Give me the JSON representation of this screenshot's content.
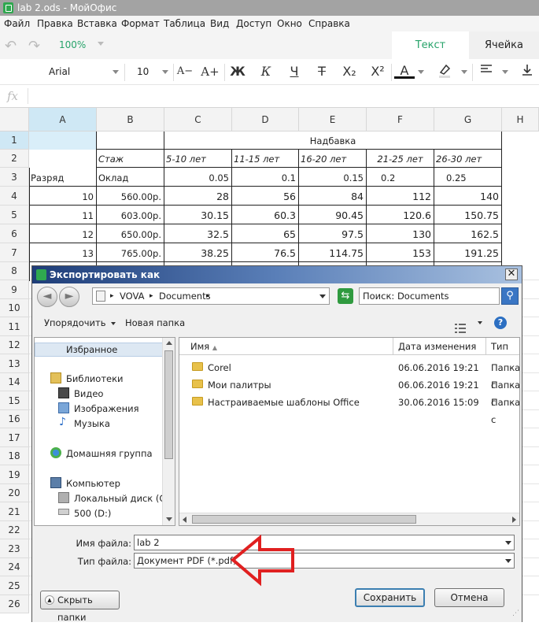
{
  "app": {
    "title": "lab 2.ods - МойОфис"
  },
  "menu": [
    "Файл",
    "Правка",
    "Вставка",
    "Формат",
    "Таблица",
    "Вид",
    "Доступ",
    "Окно",
    "Справка"
  ],
  "toolbar": {
    "zoom": "100%",
    "tab_text": "Текст",
    "tab_cell": "Ячейка",
    "font_name": "Arial",
    "font_size": "10",
    "format_buttons": [
      "A−",
      "A+",
      "Ж",
      "К",
      "Ч",
      "Т",
      "X₂",
      "X²",
      "A",
      "",
      "",
      ""
    ]
  },
  "formula_bar": {
    "fx_label": "fx"
  },
  "sheet": {
    "columns": [
      "A",
      "B",
      "C",
      "D",
      "E",
      "F",
      "G",
      "H"
    ],
    "rows": [
      "1",
      "2",
      "3",
      "4",
      "5",
      "6",
      "7",
      "8",
      "9",
      "10",
      "11",
      "12",
      "13",
      "14",
      "15",
      "16",
      "17",
      "18",
      "19",
      "20",
      "21",
      "22",
      "23",
      "24",
      "25",
      "26"
    ],
    "header_nadbavka": "Надбавка",
    "row2": {
      "b": "Стаж",
      "c": "5-10 лет",
      "d": "11-15 лет",
      "e": "16-20 лет",
      "f": "21-25 лет",
      "g": "26-30 лет"
    },
    "row3": {
      "a": "Разряд",
      "b": "Оклад",
      "c": "0.05",
      "d": "0.1",
      "e": "0.15",
      "f": "0.2",
      "g": "0.25"
    },
    "data_rows": [
      {
        "a": "10",
        "b": "560.00р.",
        "c": "28",
        "d": "56",
        "e": "84",
        "f": "112",
        "g": "140"
      },
      {
        "a": "11",
        "b": "603.00р.",
        "c": "30.15",
        "d": "60.3",
        "e": "90.45",
        "f": "120.6",
        "g": "150.75"
      },
      {
        "a": "12",
        "b": "650.00р.",
        "c": "32.5",
        "d": "65",
        "e": "97.5",
        "f": "130",
        "g": "162.5"
      },
      {
        "a": "13",
        "b": "765.00р.",
        "c": "38.25",
        "d": "76.5",
        "e": "114.75",
        "f": "153",
        "g": "191.25"
      }
    ]
  },
  "dialog": {
    "title": "Экспортировать как",
    "path": [
      "VOVA",
      "Documents"
    ],
    "search_placeholder": "Поиск: Documents",
    "organize": "Упорядочить",
    "new_folder": "Новая папка",
    "nav": {
      "favorites": "Избранное",
      "libraries": "Библиотеки",
      "video": "Видео",
      "images": "Изображения",
      "music": "Музыка",
      "homegroup": "Домашняя группа",
      "computer": "Компьютер",
      "local_disk": "Локальный диск (C:)",
      "drive_d": "500 (D:)"
    },
    "columns": {
      "name": "Имя",
      "date": "Дата изменения",
      "type": "Тип"
    },
    "files": [
      {
        "name": "Corel",
        "date": "06.06.2016 19:21",
        "type": "Папка с"
      },
      {
        "name": "Мои палитры",
        "date": "06.06.2016 19:21",
        "type": "Папка с"
      },
      {
        "name": "Настраиваемые шаблоны Office",
        "date": "30.06.2016 15:09",
        "type": "Папка с"
      }
    ],
    "filename_label": "Имя файла:",
    "filename_value": "lab 2",
    "filetype_label": "Тип файла:",
    "filetype_value": "Документ PDF (*.pdf)",
    "hide_folders": "Скрыть папки",
    "save": "Сохранить",
    "cancel": "Отмена"
  },
  "colors": {
    "accent_green": "#27a36a",
    "selection_blue": "#cfe8f5",
    "annotation_red": "#e02020"
  }
}
